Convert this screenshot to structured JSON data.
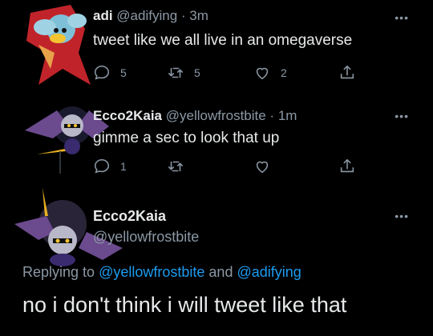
{
  "tweets": [
    {
      "display_name": "adi",
      "handle": "@adifying",
      "time": "3m",
      "text": "tweet like we all live in an omegaverse",
      "reply_count": "5",
      "retweet_count": "5",
      "like_count": "2"
    },
    {
      "display_name": "Ecco2Kaia",
      "handle": "@yellowfrostbite",
      "time": "1m",
      "text": "gimme a sec to look that up",
      "reply_count": "1",
      "retweet_count": "",
      "like_count": ""
    }
  ],
  "detail": {
    "display_name": "Ecco2Kaia",
    "handle": "@yellowfrostbite",
    "replying_prefix": "Replying to",
    "replying_user1": "@yellowfrostbite",
    "replying_and": "and",
    "replying_user2": "@adifying",
    "text": "no i don't think i will tweet like that"
  },
  "icons": {
    "reply": "reply-icon",
    "retweet": "retweet-icon",
    "like": "heart-icon",
    "share": "share-icon",
    "more": "more-icon"
  },
  "colors": {
    "background": "#000000",
    "text": "#e7e9ea",
    "muted": "#8b98a5",
    "link": "#1d9bf0"
  }
}
